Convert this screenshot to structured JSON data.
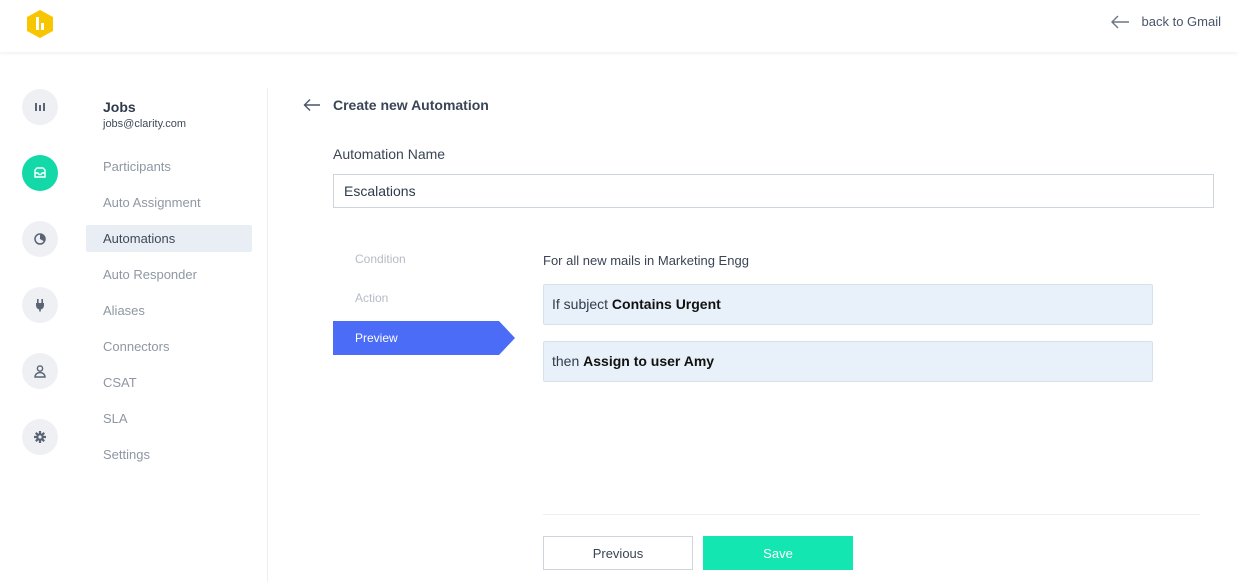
{
  "header": {
    "back_label": "back to Gmail"
  },
  "rail": {
    "items": [
      {
        "icon": "bar-chart-icon",
        "active": false
      },
      {
        "icon": "inbox-icon",
        "active": true
      },
      {
        "icon": "pie-chart-icon",
        "active": false
      },
      {
        "icon": "plug-icon",
        "active": false
      },
      {
        "icon": "user-icon",
        "active": false
      },
      {
        "icon": "gear-icon",
        "active": false
      }
    ]
  },
  "account": {
    "name": "Jobs",
    "email": "jobs@clarity.com"
  },
  "subnav": {
    "items": [
      {
        "label": "Participants"
      },
      {
        "label": "Auto Assignment"
      },
      {
        "label": "Automations",
        "active": true
      },
      {
        "label": "Auto Responder"
      },
      {
        "label": "Aliases"
      },
      {
        "label": "Connectors"
      },
      {
        "label": "CSAT"
      },
      {
        "label": "SLA"
      },
      {
        "label": "Settings"
      }
    ]
  },
  "page": {
    "title": "Create new Automation",
    "name_label": "Automation Name",
    "name_value": "Escalations"
  },
  "steps": [
    {
      "label": "Condition"
    },
    {
      "label": "Action"
    },
    {
      "label": "Preview",
      "active": true
    }
  ],
  "preview": {
    "intro": "For all new mails in Marketing Engg",
    "condition_prefix": "If subject",
    "condition_bold": "Contains Urgent",
    "action_prefix": "then",
    "action_bold": "Assign to user Amy"
  },
  "buttons": {
    "previous": "Previous",
    "save": "Save"
  },
  "colors": {
    "accent_green": "#13e6b0",
    "rail_active": "#13d8a8",
    "step_active": "#4a6cf7",
    "logo_yellow": "#f7c600"
  }
}
